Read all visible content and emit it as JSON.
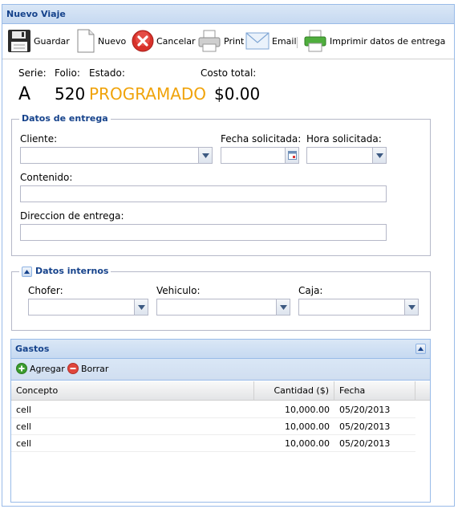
{
  "panel": {
    "title": "Nuevo Viaje"
  },
  "toolbar": {
    "guardar": "Guardar",
    "nuevo": "Nuevo",
    "cancelar": "Cancelar",
    "print": "Print",
    "email": "Email",
    "imprimir": "Imprimir datos de entrega"
  },
  "header": {
    "serie_label": "Serie:",
    "folio_label": "Folio:",
    "estado_label": "Estado:",
    "costo_label": "Costo total:",
    "serie": "A",
    "folio": "520",
    "estado": "PROGRAMADO",
    "costo": "$0.00"
  },
  "entrega": {
    "title": "Datos de entrega",
    "cliente_label": "Cliente:",
    "cliente_value": "",
    "fecha_label": "Fecha solicitada:",
    "fecha_value": "",
    "hora_label": "Hora solicitada:",
    "hora_value": "",
    "contenido_label": "Contenido:",
    "contenido_value": "",
    "direccion_label": "Direccion de entrega:",
    "direccion_value": ""
  },
  "internos": {
    "title": "Datos internos",
    "chofer_label": "Chofer:",
    "chofer_value": "",
    "vehiculo_label": "Vehiculo:",
    "vehiculo_value": "",
    "caja_label": "Caja:",
    "caja_value": ""
  },
  "gastos": {
    "title": "Gastos",
    "agregar": "Agregar",
    "borrar": "Borrar",
    "columns": [
      "Concepto",
      "Cantidad ($)",
      "Fecha"
    ],
    "rows": [
      {
        "concepto": "cell",
        "cantidad": "10,000.00",
        "fecha": "05/20/2013"
      },
      {
        "concepto": "cell",
        "cantidad": "10,000.00",
        "fecha": "05/20/2013"
      },
      {
        "concepto": "cell",
        "cantidad": "10,000.00",
        "fecha": "05/20/2013"
      }
    ]
  },
  "colors": {
    "accent": "#15428b",
    "estado": "#f0a30a",
    "border": "#99bbe8"
  }
}
